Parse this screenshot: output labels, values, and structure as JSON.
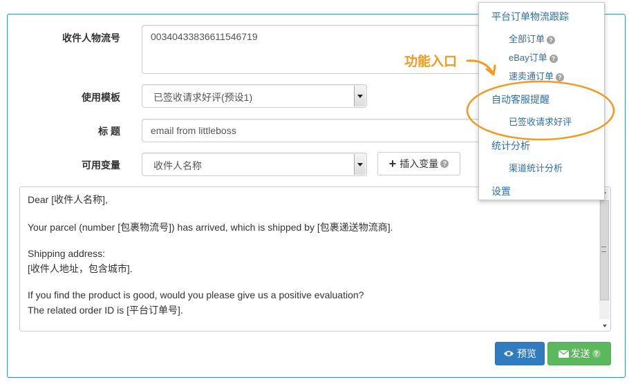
{
  "form": {
    "tracking_label": "收件人物流号",
    "tracking_value": "00340433836611546719",
    "template_label": "使用模板",
    "template_value": "已签收请求好评(预设1)",
    "title_label": "标 题",
    "title_value": "email from littleboss",
    "variables_label": "可用变量",
    "variables_value": "收件人名称",
    "insert_button": "插入变量",
    "insert_button_icon": "plus-icon"
  },
  "body_lines": [
    "Dear [收件人名称],",
    "Your parcel (number [包裹物流号]) has arrived, which is shipped by [包裹递送物流商].",
    "Shipping address:",
    "[收件人地址，包含城市].",
    "If you find the product is good, would you please give us a positive evaluation?",
    "The related order ID is [平台订单号]."
  ],
  "actions": {
    "preview_label": "预览",
    "preview_icon": "eye-icon",
    "send_label": "发送",
    "send_icon": "envelope-icon",
    "preview_color": "#2f7cc0",
    "send_color": "#5cb85c"
  },
  "menu": {
    "items": [
      {
        "label": "平台订单物流跟踪",
        "level": 1
      },
      {
        "label": "全部订单",
        "level": 2,
        "help": "?"
      },
      {
        "label": "eBay订单",
        "level": 2,
        "help": "?"
      },
      {
        "label": "速卖通订单",
        "level": 2,
        "help": "?"
      },
      {
        "label": "自动客服提醒",
        "level": 1
      },
      {
        "label": "已签收请求好评",
        "level": 2
      },
      {
        "label": "统计分析",
        "level": 1
      },
      {
        "label": "渠道统计分析",
        "level": 2
      },
      {
        "label": "设置",
        "level": 1
      }
    ]
  },
  "annotation": {
    "text": "功能入口",
    "color": "#f39a1e"
  },
  "help_mark": "?"
}
